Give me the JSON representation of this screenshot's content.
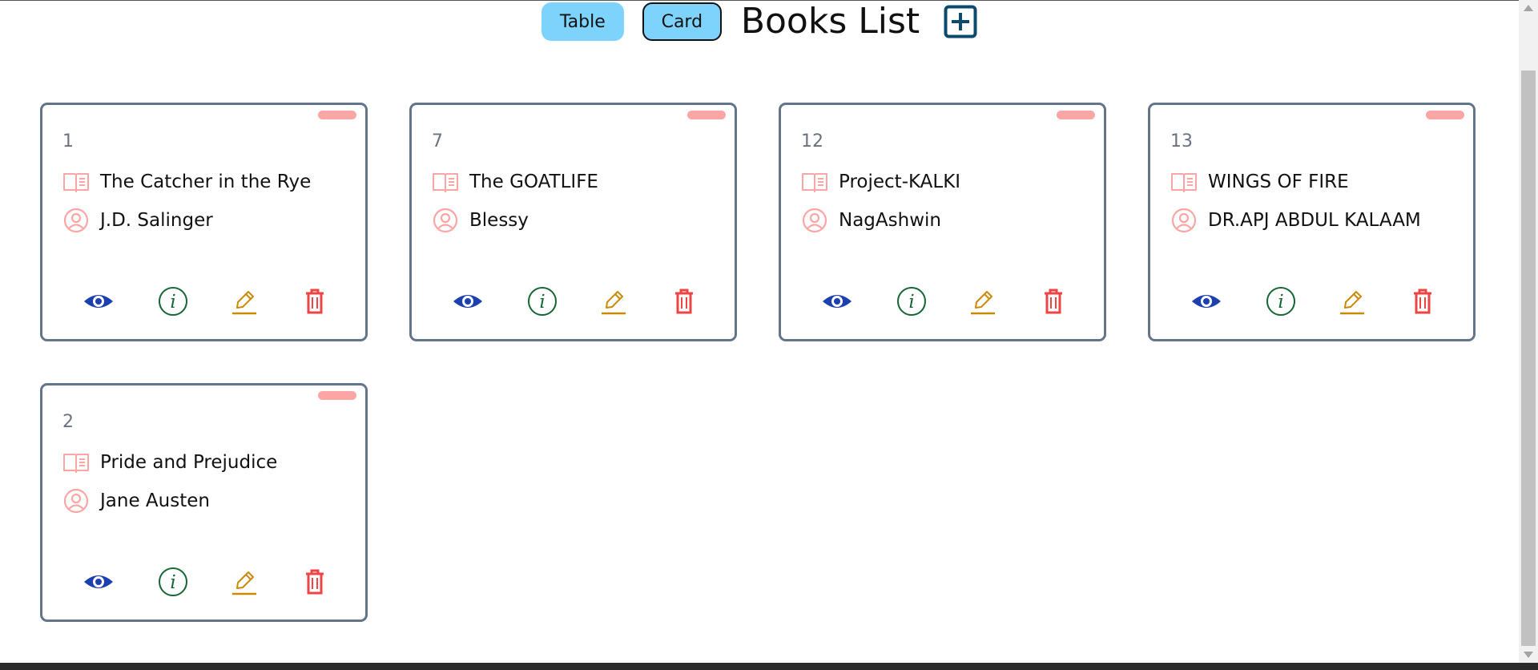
{
  "header": {
    "table_label": "Table",
    "card_label": "Card",
    "title": "Books List",
    "add_icon": "plus-square-icon"
  },
  "colors": {
    "toggle_bg": "#7dd3fc",
    "card_border": "#64748b",
    "badge": "#fca5a5",
    "view": "#1e40af",
    "info": "#166534",
    "edit": "#ca8a04",
    "delete": "#ef4444",
    "add": "#0c4a6e"
  },
  "books": [
    {
      "id": "1",
      "title": "The Catcher in the Rye",
      "author": "J.D. Salinger"
    },
    {
      "id": "7",
      "title": "The GOATLIFE",
      "author": "Blessy"
    },
    {
      "id": "12",
      "title": "Project-KALKI",
      "author": "NagAshwin"
    },
    {
      "id": "13",
      "title": "WINGS OF FIRE",
      "author": "DR.APJ ABDUL KALAAM"
    },
    {
      "id": "2",
      "title": "Pride and Prejudice",
      "author": "Jane Austen"
    }
  ],
  "card_icons": {
    "title": "book-open-icon",
    "author": "user-circle-icon",
    "actions": [
      "eye-icon",
      "info-circle-icon",
      "pencil-icon",
      "trash-icon"
    ]
  }
}
